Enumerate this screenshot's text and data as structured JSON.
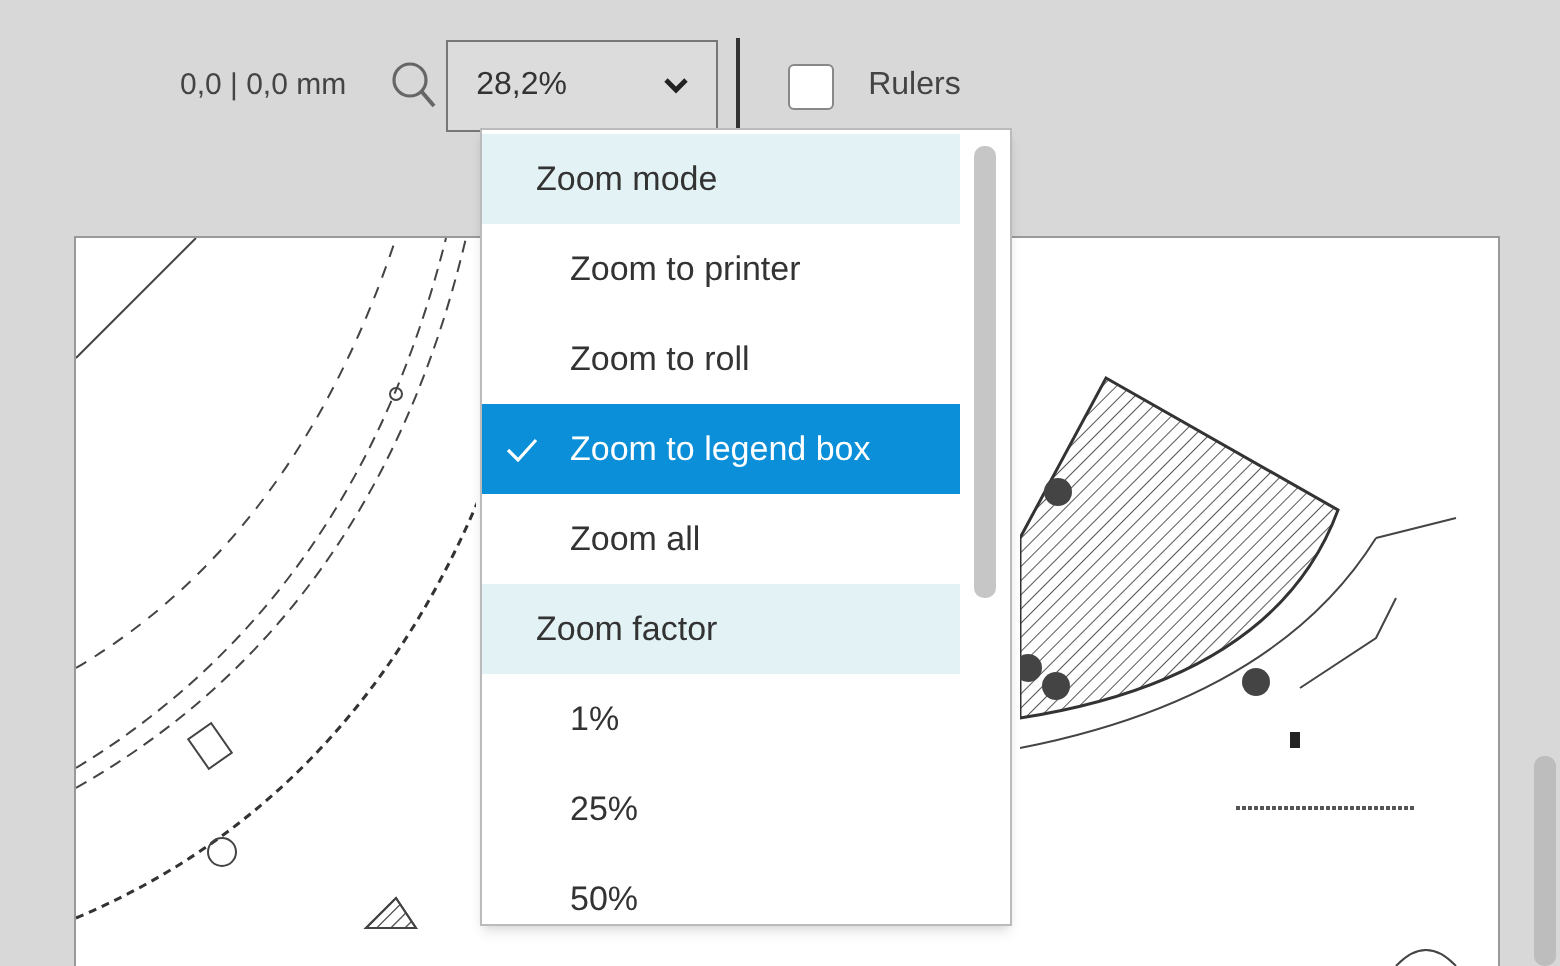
{
  "toolbar": {
    "coordinates": "0,0 | 0,0 mm",
    "zoom_value": "28,2%",
    "rulers": {
      "label": "Rulers",
      "checked": false
    }
  },
  "zoom_menu": {
    "items": [
      {
        "kind": "header",
        "label": "Zoom mode"
      },
      {
        "kind": "option",
        "label": "Zoom to printer",
        "selected": false
      },
      {
        "kind": "option",
        "label": "Zoom to roll",
        "selected": false
      },
      {
        "kind": "option",
        "label": "Zoom to legend box",
        "selected": true
      },
      {
        "kind": "option",
        "label": "Zoom all",
        "selected": false
      },
      {
        "kind": "header",
        "label": "Zoom factor"
      },
      {
        "kind": "option",
        "label": "1%",
        "selected": false
      },
      {
        "kind": "option",
        "label": "25%",
        "selected": false
      },
      {
        "kind": "option",
        "label": "50%",
        "selected": false
      }
    ]
  }
}
